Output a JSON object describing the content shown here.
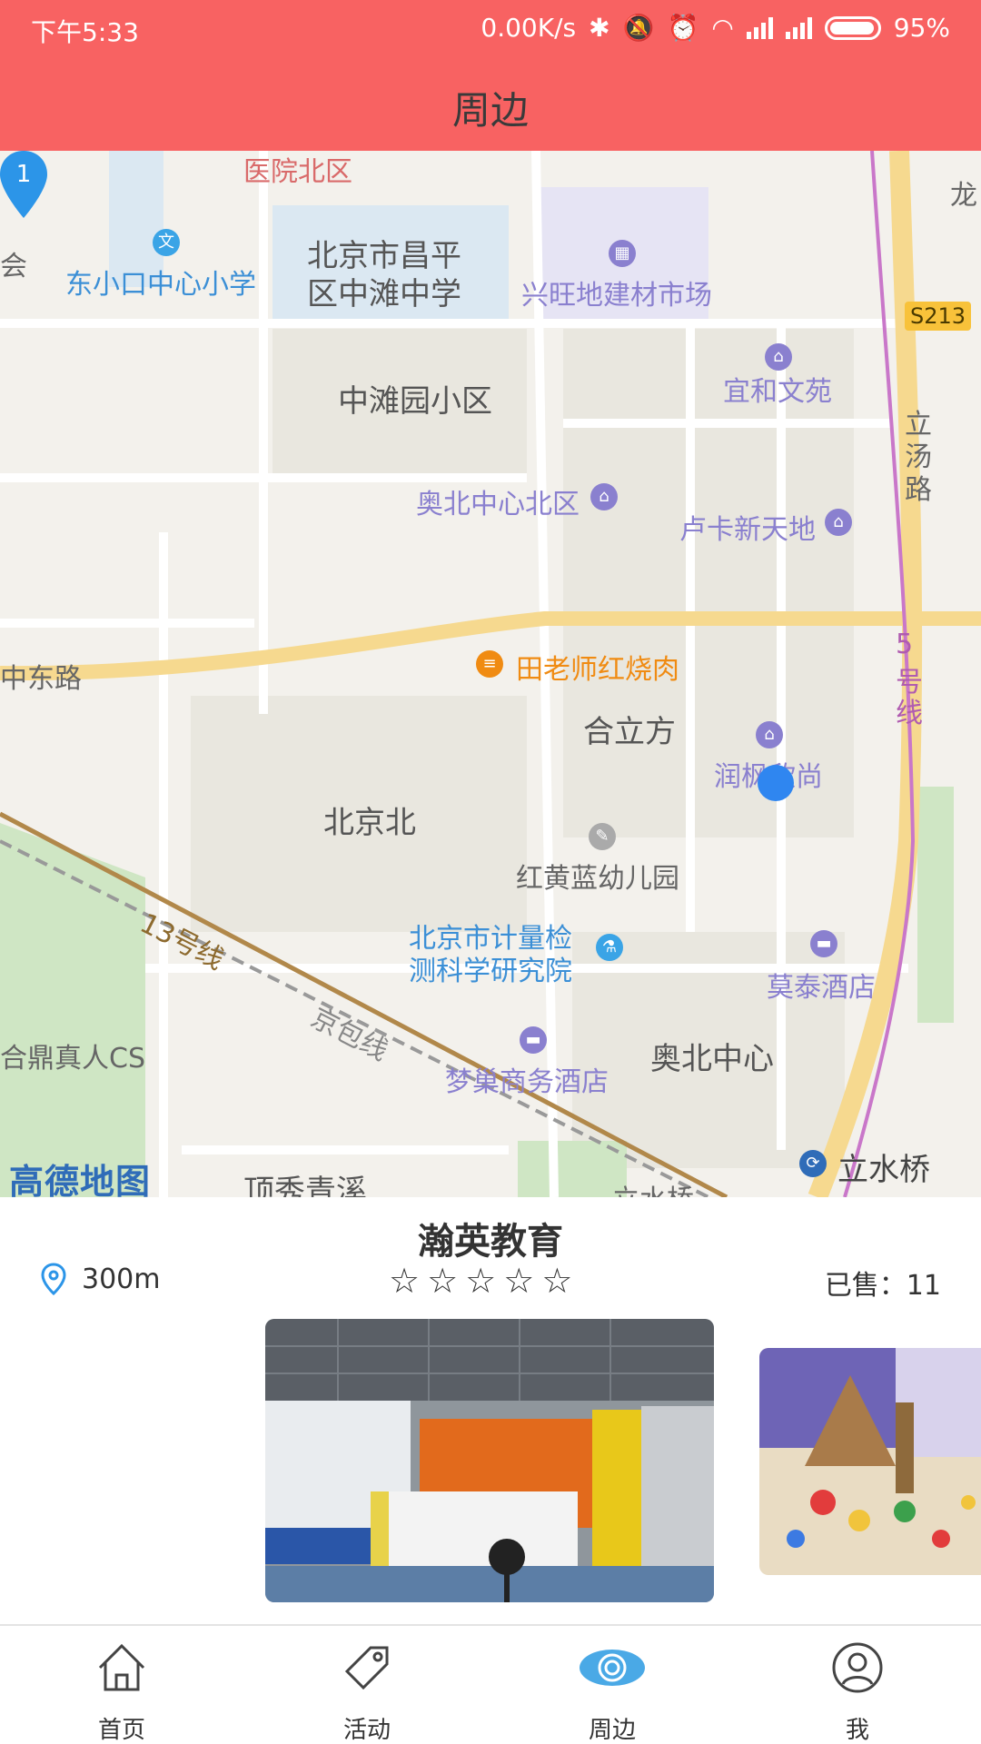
{
  "status_bar": {
    "time": "下午5:33",
    "speed": "0.00K/s",
    "battery": "95%"
  },
  "header": {
    "title": "周边"
  },
  "map": {
    "labels": {
      "hospital": "医院北区",
      "school1": "东小口中心小学",
      "school2_line1": "北京市昌平",
      "school2_line2": "区中滩中学",
      "market": "兴旺地建材市场",
      "road_badge": "S213",
      "yihe": "宜和文苑",
      "lit_road1": "立",
      "lit_road2": "汤",
      "lit_road3": "路",
      "zhongtan": "中滩园小区",
      "aobei_north": "奥北中心北区",
      "luka": "卢卡新天地",
      "restaurant": "田老师红烧肉",
      "road_east": "中东路",
      "line5_1": "5",
      "line5_2": "号",
      "line5_3": "线",
      "helifang": "合立方",
      "runfeng": "润枫欣尚",
      "beijingbei": "北京北",
      "kindergarten": "红黄蓝幼儿园",
      "line13": "13号线",
      "institute_line1": "北京市计量检",
      "institute_line2": "测科学研究院",
      "motai": "莫泰酒店",
      "jingbao": "京包线",
      "cs": "合鼎真人CS",
      "aobei_center": "奥北中心",
      "mengchao": "梦巢商务酒店",
      "lishuiqiao": "立水桥",
      "dingxiu": "顶秀青溪",
      "lishuiqiao2": "立水桥",
      "long": "龙",
      "hui": "会",
      "logo": "高德地图",
      "pin_number": "1"
    }
  },
  "shop": {
    "name": "瀚英教育",
    "distance": "300m",
    "rating": 0,
    "max_rating": 5,
    "sold": "已售：11",
    "photos": [
      "瀚英教育 lobby photo",
      "indoor sandbox playground photo"
    ]
  },
  "tabs": [
    {
      "label": "首页",
      "icon": "home-icon",
      "active": false
    },
    {
      "label": "活动",
      "icon": "tag-icon",
      "active": false
    },
    {
      "label": "周边",
      "icon": "eye-icon",
      "active": true
    },
    {
      "label": "我",
      "icon": "user-icon",
      "active": false
    }
  ],
  "colors": {
    "header": "#f86262",
    "active_tab": "#3aa4e6",
    "map_bg": "#f3f1ec"
  }
}
